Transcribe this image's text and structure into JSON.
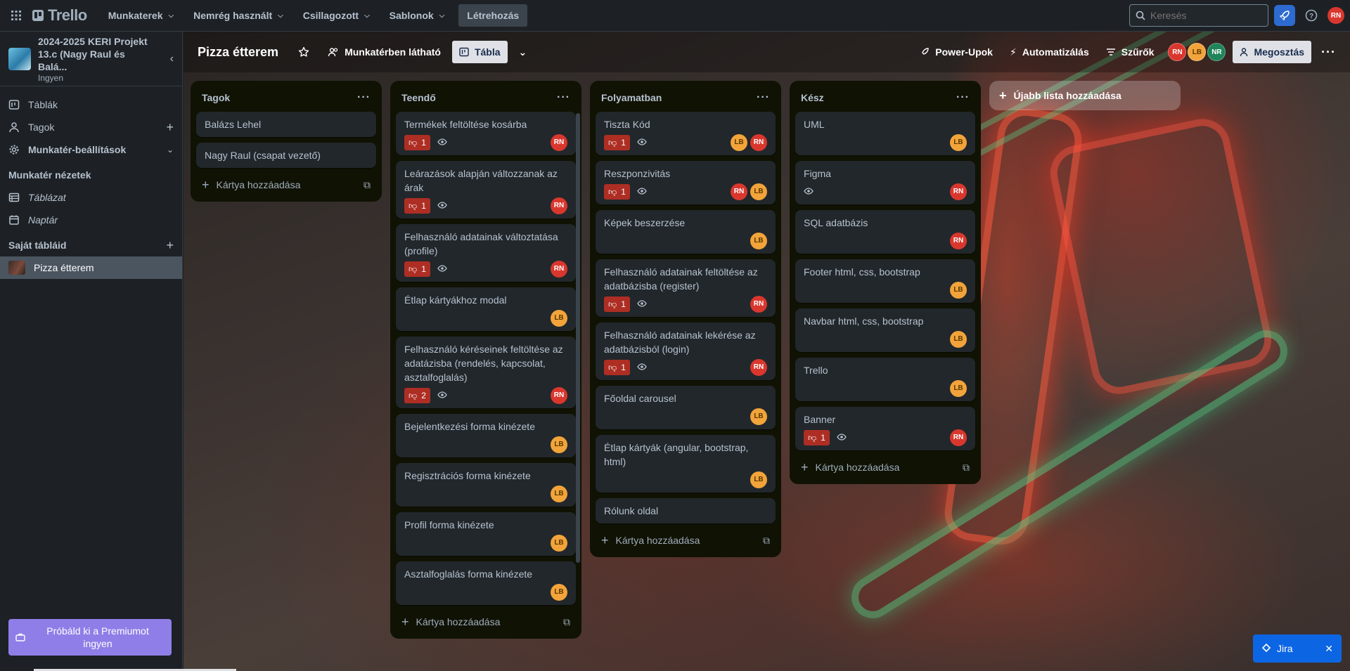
{
  "topnav": {
    "logo": "Trello",
    "menu": [
      {
        "label": "Munkaterek"
      },
      {
        "label": "Nemrég használt"
      },
      {
        "label": "Csillagozott"
      },
      {
        "label": "Sablonok"
      }
    ],
    "create_label": "Létrehozás",
    "search_placeholder": "Keresés",
    "user_initials": "RN"
  },
  "sidebar": {
    "workspace_title": "2024-2025 KERI Projekt 13.c (Nagy Raul és Balá...",
    "workspace_plan": "Ingyen",
    "items": [
      {
        "label": "Táblák"
      },
      {
        "label": "Tagok"
      },
      {
        "label": "Munkatér-beállítások"
      }
    ],
    "views_heading": "Munkatér nézetek",
    "views": [
      {
        "label": "Táblázat"
      },
      {
        "label": "Naptár"
      }
    ],
    "boards_heading": "Saját tábláid",
    "boards": [
      {
        "label": "Pizza étterem"
      }
    ],
    "premium_label": "Próbáld ki a Premiumot ingyen"
  },
  "boardbar": {
    "title": "Pizza étterem",
    "visibility": "Munkatérben látható",
    "view": "Tábla",
    "powerups": "Power-Upok",
    "automation": "Automatizálás",
    "filters": "Szűrők",
    "members": [
      "RN",
      "LB",
      "NR"
    ],
    "share": "Megosztás"
  },
  "lists": [
    {
      "title": "Tagok",
      "add_label": "Kártya hozzáadása",
      "cards": [
        {
          "title": "Balázs Lehel",
          "votes": null,
          "watch": false,
          "members": []
        },
        {
          "title": "Nagy Raul (csapat vezető)",
          "votes": null,
          "watch": false,
          "members": []
        }
      ]
    },
    {
      "title": "Teendő",
      "add_label": "Kártya hozzáadása",
      "cards": [
        {
          "title": "Termékek feltöltése kosárba",
          "votes": "1",
          "watch": true,
          "members": [
            "RN"
          ]
        },
        {
          "title": "Leárazások alapján változzanak az árak",
          "votes": "1",
          "watch": true,
          "members": [
            "RN"
          ]
        },
        {
          "title": "Felhasználó adatainak változtatása (profile)",
          "votes": "1",
          "watch": true,
          "members": [
            "RN"
          ]
        },
        {
          "title": "Étlap kártyákhoz modal",
          "votes": null,
          "watch": false,
          "members": [
            "LB"
          ]
        },
        {
          "title": "Felhasználó kéréseinek feltöltése az adatázisba (rendelés, kapcsolat, asztalfoglalás)",
          "votes": "2",
          "watch": true,
          "members": [
            "RN"
          ]
        },
        {
          "title": "Bejelentkezési forma kinézete",
          "votes": null,
          "watch": false,
          "members": [
            "LB"
          ]
        },
        {
          "title": "Regisztrációs forma kinézete",
          "votes": null,
          "watch": false,
          "members": [
            "LB"
          ]
        },
        {
          "title": "Profil forma kinézete",
          "votes": null,
          "watch": false,
          "members": [
            "LB"
          ]
        },
        {
          "title": "Asztalfoglalás forma kinézete",
          "votes": null,
          "watch": false,
          "members": [
            "LB"
          ]
        }
      ]
    },
    {
      "title": "Folyamatban",
      "add_label": "Kártya hozzáadása",
      "cards": [
        {
          "title": "Tiszta Kód",
          "votes": "1",
          "watch": true,
          "members": [
            "LB",
            "RN"
          ]
        },
        {
          "title": "Reszponzivitás",
          "votes": "1",
          "watch": true,
          "members": [
            "RN",
            "LB"
          ]
        },
        {
          "title": "Képek beszerzése",
          "votes": null,
          "watch": false,
          "members": [
            "LB"
          ]
        },
        {
          "title": "Felhasználó adatainak feltöltése az adatbázisba (register)",
          "votes": "1",
          "watch": true,
          "members": [
            "RN"
          ]
        },
        {
          "title": "Felhasználó adatainak lekérése az adatbázisból (login)",
          "votes": "1",
          "watch": true,
          "members": [
            "RN"
          ]
        },
        {
          "title": "Főoldal carousel",
          "votes": null,
          "watch": false,
          "members": [
            "LB"
          ]
        },
        {
          "title": "Étlap kártyák (angular, bootstrap, html)",
          "votes": null,
          "watch": false,
          "members": [
            "LB"
          ]
        },
        {
          "title": "Rólunk oldal",
          "votes": null,
          "watch": false,
          "members": []
        }
      ]
    },
    {
      "title": "Kész",
      "add_label": "Kártya hozzáadása",
      "cards": [
        {
          "title": "UML",
          "votes": null,
          "watch": false,
          "members": [
            "LB"
          ]
        },
        {
          "title": "Figma",
          "votes": null,
          "watch": true,
          "members": [
            "RN"
          ]
        },
        {
          "title": "SQL adatbázis",
          "votes": null,
          "watch": false,
          "members": [
            "RN"
          ]
        },
        {
          "title": "Footer html, css, bootstrap",
          "votes": null,
          "watch": false,
          "members": [
            "LB"
          ]
        },
        {
          "title": "Navbar html, css, bootstrap",
          "votes": null,
          "watch": false,
          "members": [
            "LB"
          ]
        },
        {
          "title": "Trello",
          "votes": null,
          "watch": false,
          "members": [
            "LB"
          ]
        },
        {
          "title": "Banner",
          "votes": "1",
          "watch": true,
          "members": [
            "RN"
          ]
        }
      ]
    }
  ],
  "add_list_label": "Újabb lista hozzáadása",
  "jira_label": "Jira"
}
